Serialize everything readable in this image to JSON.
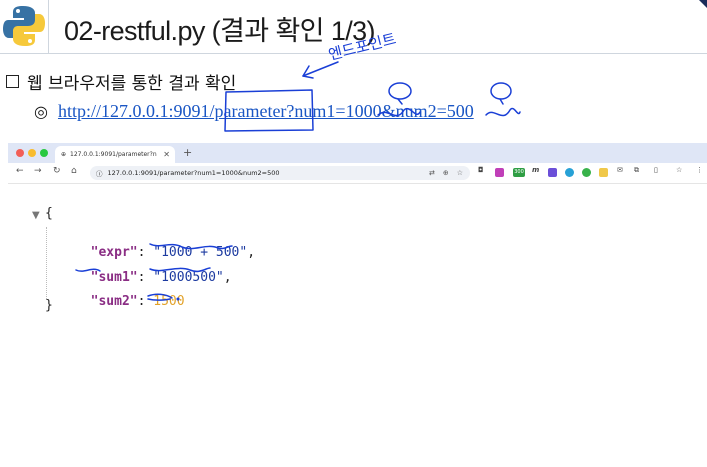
{
  "slide": {
    "title": "02-restful.py (결과 확인 1/3)",
    "bullet1": "웹 브라우저를 통한 결과 확인",
    "bullet2_link": "http://127.0.0.1:9091/parameter?num1=1000&num2=500"
  },
  "browser": {
    "tab_title": "127.0.0.1:9091/parameter?n",
    "address": "127.0.0.1:9091/parameter?num1=1000&num2=500",
    "extension_badge": "300"
  },
  "json_viewer": {
    "open_brace": "{",
    "close_brace": "}",
    "expr_key": "\"expr\"",
    "expr_value": "\"1000 + 500\"",
    "sum1_key": "\"sum1\"",
    "sum1_value": "\"1000500\"",
    "sum2_key": "\"sum2\"",
    "sum2_value": "1500"
  },
  "annotation": {
    "handwritten_note": "엔드포인트"
  },
  "colors": {
    "ink": "#1a3fd6",
    "link": "#1a56c4",
    "json_key": "#8a2d84",
    "json_string": "#1c3aa0",
    "json_number": "#e2a22a"
  }
}
